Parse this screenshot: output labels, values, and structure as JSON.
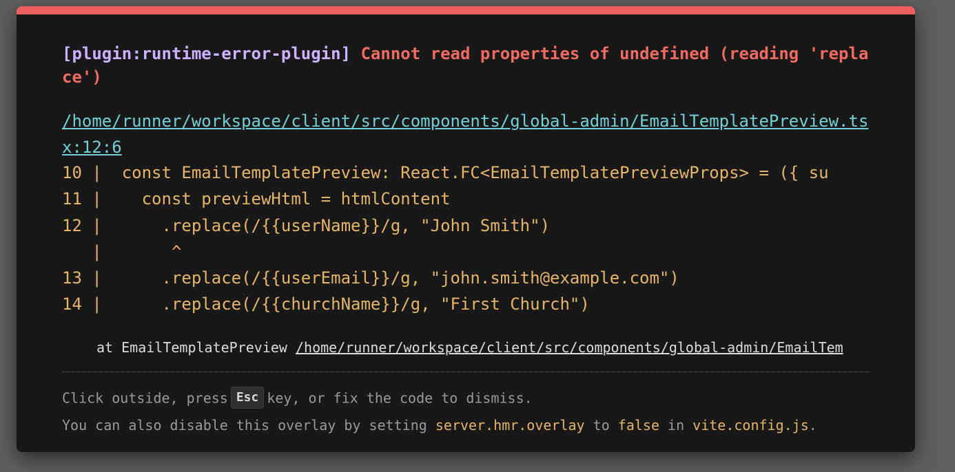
{
  "error": {
    "plugin": "[plugin:runtime-error-plugin]",
    "message": "Cannot read properties of undefined (reading 'replace')"
  },
  "file": {
    "path": "/home/runner/workspace/client/src/components/global-admin/EmailTemplatePreview.tsx:12:6"
  },
  "code_frame": [
    "10 |  const EmailTemplatePreview: React.FC<EmailTemplatePreviewProps> = ({ su",
    "11 |    const previewHtml = htmlContent",
    "12 |      .replace(/{{userName}}/g, \"John Smith\")",
    "   |       ^",
    "13 |      .replace(/{{userEmail}}/g, \"john.smith@example.com\")",
    "14 |      .replace(/{{churchName}}/g, \"First Church\")"
  ],
  "stack": {
    "prefix": "at EmailTemplatePreview",
    "link": "/home/runner/workspace/client/src/components/global-admin/EmailTem"
  },
  "tip": {
    "line1_before": "Click outside, press",
    "key": "Esc",
    "line1_after": "key, or fix the code to dismiss.",
    "line2_part1": "You can also disable this overlay by setting ",
    "line2_code1": "server.hmr.overlay",
    "line2_part2": " to ",
    "line2_code2": "false",
    "line2_part3": " in ",
    "line2_code3": "vite.config.js",
    "line2_part4": "."
  },
  "colors": {
    "accent_bar": "#ee5f5f",
    "plugin": "#c9b3ff",
    "error": "#ee6b5f",
    "link": "#73d0d6",
    "code": "#e6b567"
  }
}
